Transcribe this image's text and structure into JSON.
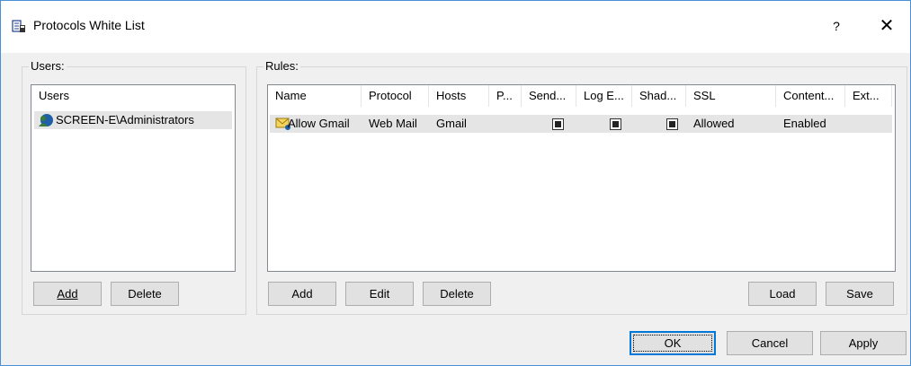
{
  "window": {
    "title": "Protocols White List",
    "help": "?",
    "close": "✕"
  },
  "users": {
    "group_label": "Users:",
    "column": "Users",
    "items": [
      {
        "name": "SCREEN-E\\Administrators"
      }
    ],
    "add": "Add",
    "delete": "Delete"
  },
  "rules": {
    "group_label": "Rules:",
    "columns": [
      "Name",
      "Protocol",
      "Hosts",
      "P...",
      "Send...",
      "Log E...",
      "Shad...",
      "SSL",
      "Content...",
      "Ext..."
    ],
    "rows": [
      {
        "name": "Allow Gmail",
        "protocol": "Web Mail",
        "hosts": "Gmail",
        "p": "",
        "send": true,
        "log": true,
        "shadow": true,
        "ssl": "Allowed",
        "content": "Enabled",
        "ext": ""
      }
    ],
    "add": "Add",
    "edit": "Edit",
    "delete": "Delete",
    "load": "Load",
    "save": "Save"
  },
  "footer": {
    "ok": "OK",
    "cancel": "Cancel",
    "apply": "Apply"
  },
  "colors": {
    "accent": "#0078d7",
    "selection": "#e5e5e5",
    "window_border": "#4a90d9"
  }
}
